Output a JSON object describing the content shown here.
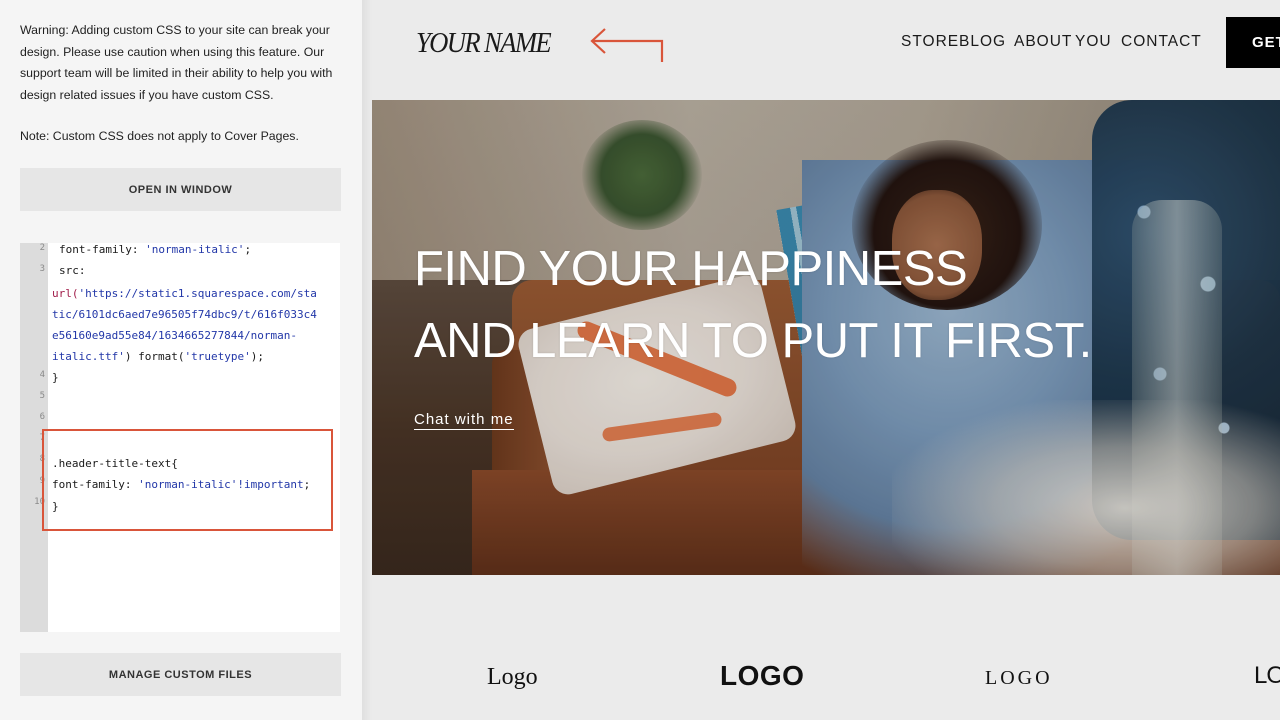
{
  "panel": {
    "warning": "Warning: Adding custom CSS to your site can break your design. Please use caution when using this feature. Our support team will be limited in their ability to help you with design related issues if you have custom CSS.",
    "note": "Note: Custom CSS does not apply to Cover Pages.",
    "open_button": "OPEN IN WINDOW",
    "manage_button": "MANAGE CUSTOM FILES"
  },
  "editor": {
    "line_numbers": [
      "2",
      "3",
      "4",
      "5",
      "6",
      "7",
      "8",
      "9",
      "10"
    ],
    "lines": {
      "l2_prop": "font-family: ",
      "l2_val": "'norman-italic'",
      "l2_end": ";",
      "l3_prop": "src:",
      "l3_url_fn": "url(",
      "l3_url_1": "'https://static1.squarespace.com/sta",
      "l3_url_2": "tic/6101dc6aed7e96505f74dbc9/t/616f033c4",
      "l3_url_3": "e56160e9ad55e84/1634665277844/norman-",
      "l3_url_4a": "italic.ttf'",
      "l3_url_4b": ") format(",
      "l3_url_4c": "'truetype'",
      "l3_url_4d": ");",
      "l4": "}",
      "l8": ".header-title-text{",
      "l9_prop": "font-family: ",
      "l9_val": "'norman-italic'!important",
      "l9_end": ";",
      "l10": "}"
    }
  },
  "site": {
    "logo": "YOUR NAME",
    "nav": [
      "STORE",
      "BLOG",
      "ABOUT",
      "YOU",
      "CONTACT"
    ],
    "cta": "GET",
    "hero_title_line1": "FIND YOUR HAPPINESS",
    "hero_title_line2": "AND LEARN TO PUT IT FIRST.",
    "hero_link": "Chat with me",
    "logos": [
      "Logo",
      "LOGO",
      "LOGO",
      "LOG"
    ]
  },
  "colors": {
    "accent_orange": "#d9553a",
    "string_blue": "#2237a8",
    "cta_black": "#000000"
  }
}
